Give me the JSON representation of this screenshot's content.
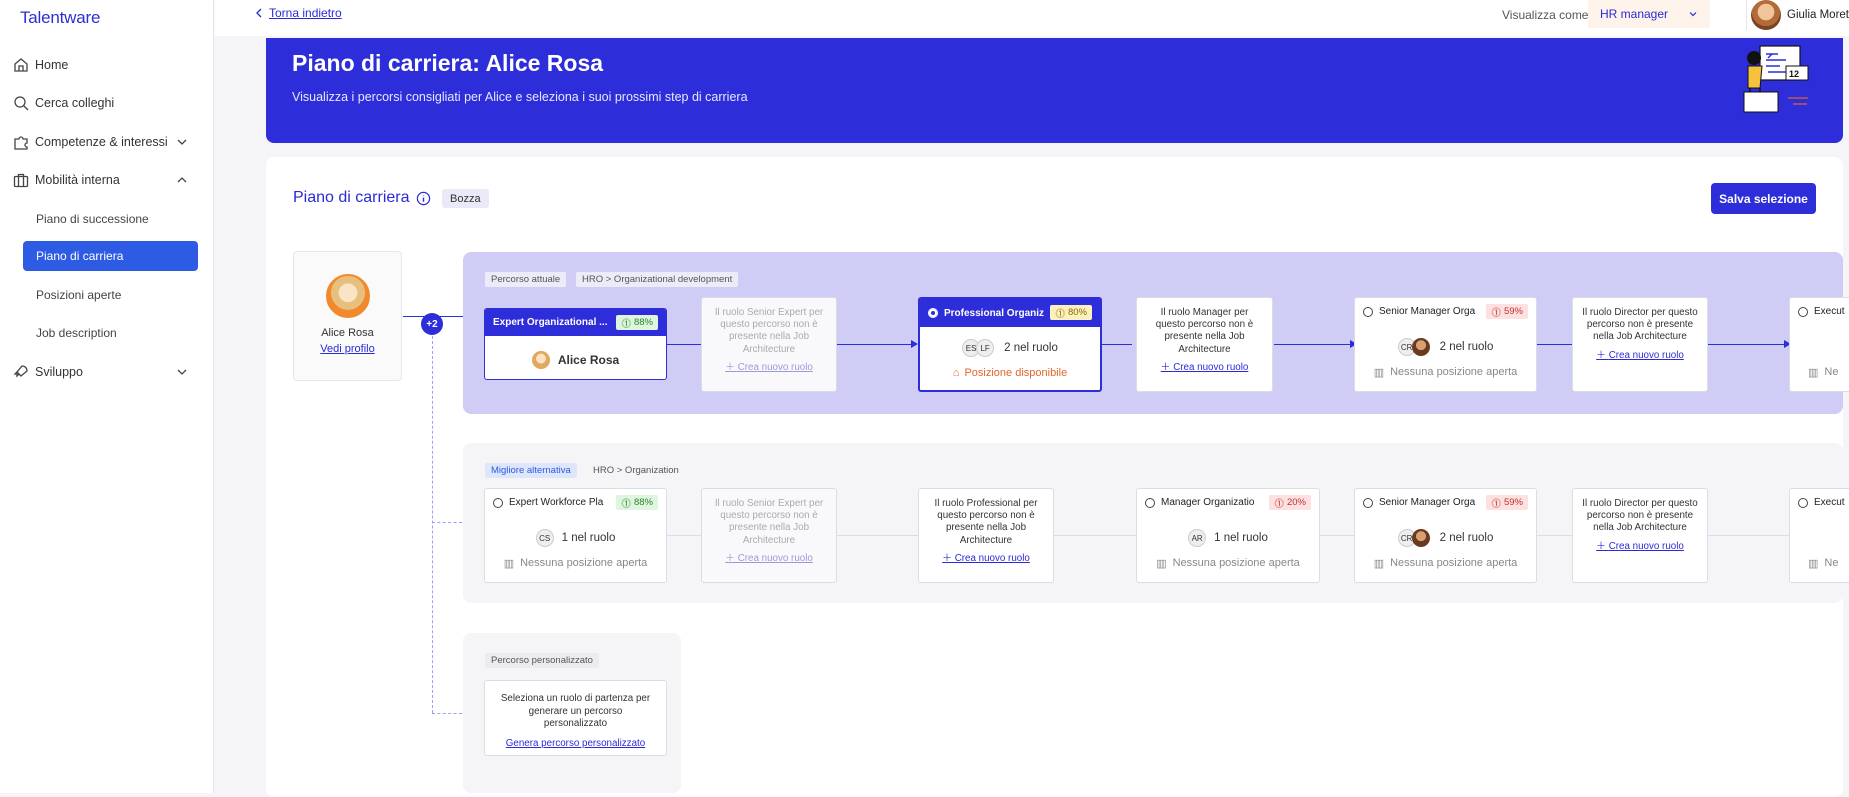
{
  "app": {
    "logo": "Talentware"
  },
  "sidebar": {
    "items": [
      {
        "label": "Home",
        "icon": "home-icon"
      },
      {
        "label": "Cerca colleghi",
        "icon": "search-icon"
      },
      {
        "label": "Competenze & interessi",
        "icon": "puzzle-icon"
      },
      {
        "label": "Mobilità interna",
        "icon": "briefcase-icon"
      },
      {
        "label": "Sviluppo",
        "icon": "rocket-icon"
      }
    ],
    "subitems": [
      "Piano di successione",
      "Piano di carriera",
      "Posizioni aperte",
      "Job description"
    ]
  },
  "topbar": {
    "back": "Torna indietro",
    "view_as_label": "Visualizza come",
    "role": "HR manager",
    "user_name": "Giulia Moretti"
  },
  "banner": {
    "title": "Piano di carriera: Alice Rosa",
    "subtitle": "Visualizza i percorsi consigliati per Alice e seleziona i suoi prossimi step di carriera",
    "illustration_number": "12"
  },
  "panel": {
    "title": "Piano di carriera",
    "status": "Bozza",
    "save": "Salva selezione",
    "more_paths": "+2"
  },
  "profile": {
    "name": "Alice Rosa",
    "link": "Vedi profilo"
  },
  "lane1": {
    "tags": [
      "Percorso attuale",
      "HRO > Organizational development"
    ],
    "current": {
      "title": "Expert Organizational ...",
      "match": "88%",
      "person": "Alice Rosa"
    },
    "gap1": {
      "text": "Il ruolo Senior Expert per questo percorso non è presente nella Job Architecture",
      "action": "Crea nuovo ruolo"
    },
    "selected": {
      "title": "Professional Organiz",
      "match": "80%",
      "people": "2 nel ruolo",
      "chips": [
        "ES",
        "LF"
      ],
      "status": "Posizione disponibile"
    },
    "gap2": {
      "text": "Il ruolo Manager per questo percorso non è presente nella Job Architecture",
      "action": "Crea nuovo ruolo"
    },
    "next": {
      "title": "Senior Manager Orga",
      "match": "59%",
      "people": "2 nel ruolo",
      "chips": [
        "CR"
      ],
      "status": "Nessuna posizione aperta"
    },
    "gap3": {
      "text": "Il ruolo Director per questo percorso non è presente nella Job Architecture",
      "action": "Crea nuovo ruolo"
    },
    "last": {
      "title": "Execut",
      "status": "Ne"
    }
  },
  "lane2": {
    "tags": [
      "Migliore alternativa",
      "HRO > Organization"
    ],
    "c1": {
      "title": "Expert Workforce Pla",
      "match": "88%",
      "people": "1 nel ruolo",
      "chips": [
        "CS"
      ],
      "status": "Nessuna posizione aperta"
    },
    "gap1": {
      "text": "Il ruolo Senior Expert per questo percorso non è presente nella Job Architecture",
      "action": "Crea nuovo ruolo"
    },
    "gap2": {
      "text": "Il ruolo Professional per questo percorso non è presente nella Job Architecture",
      "action": "Crea nuovo ruolo"
    },
    "c2": {
      "title": "Manager Organizatio",
      "match": "20%",
      "people": "1 nel ruolo",
      "chips": [
        "AR"
      ],
      "status": "Nessuna posizione aperta"
    },
    "c3": {
      "title": "Senior Manager Orga",
      "match": "59%",
      "people": "2 nel ruolo",
      "chips": [
        "CR"
      ],
      "status": "Nessuna posizione aperta"
    },
    "gap3": {
      "text": "Il ruolo Director per questo percorso non è presente nella Job Architecture",
      "action": "Crea nuovo ruolo"
    },
    "last": {
      "title": "Execut",
      "status": "Ne"
    }
  },
  "lane3": {
    "tag": "Percorso personalizzato",
    "text": "Seleziona un ruolo di partenza per generare un percorso personalizzato",
    "action": "Genera percorso personalizzato"
  },
  "colors": {
    "accent": "#2d2ed9",
    "active_nav": "#2d5be3",
    "lane_current": "#cfcdf5",
    "available": "#e0662a"
  }
}
